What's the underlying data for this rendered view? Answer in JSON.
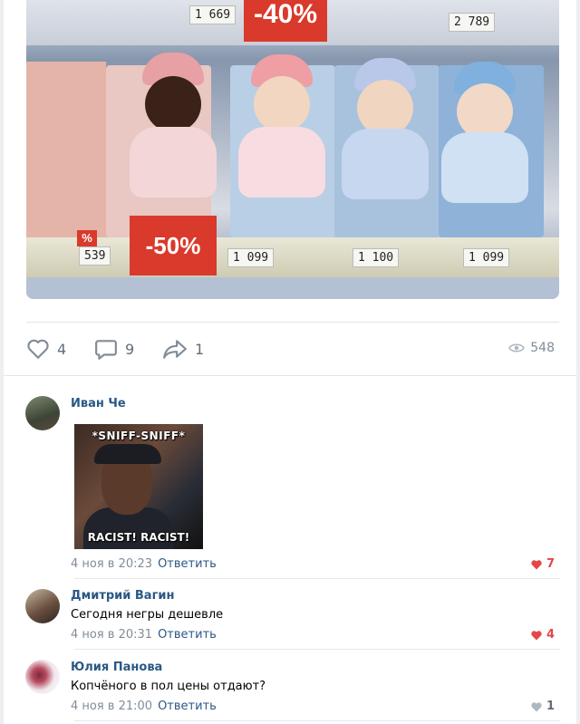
{
  "photo": {
    "prices": {
      "top_left": "1 669",
      "top_right": "2 789",
      "doll1": "539",
      "doll2": "1 099",
      "doll3": "1 100",
      "doll4": "1 099"
    },
    "sale_top": "-40%",
    "sale_bottom": "-50%",
    "sale_small": "%"
  },
  "actions": {
    "likes": "4",
    "comments": "9",
    "shares": "1",
    "views": "548"
  },
  "comments": [
    {
      "author": "Иван Че",
      "meme_top": "*SNIFF-SNIFF*",
      "meme_bottom": "RACIST! RACIST!",
      "date": "4 ноя в 20:23",
      "reply": "Ответить",
      "likes": "7"
    },
    {
      "author": "Дмитрий Вагин",
      "text": "Сегодня негры дешевле",
      "date": "4 ноя в 20:31",
      "reply": "Ответить",
      "likes": "4"
    },
    {
      "author": "Юлия Панова",
      "text": "Копчёного в пол цены отдают?",
      "date": "4 ноя в 21:00",
      "reply": "Ответить",
      "likes": "1"
    }
  ],
  "colors": {
    "link": "#2a5885",
    "meta": "#818c99",
    "like_active": "#e64646",
    "like_inactive": "#aeb7c2"
  }
}
